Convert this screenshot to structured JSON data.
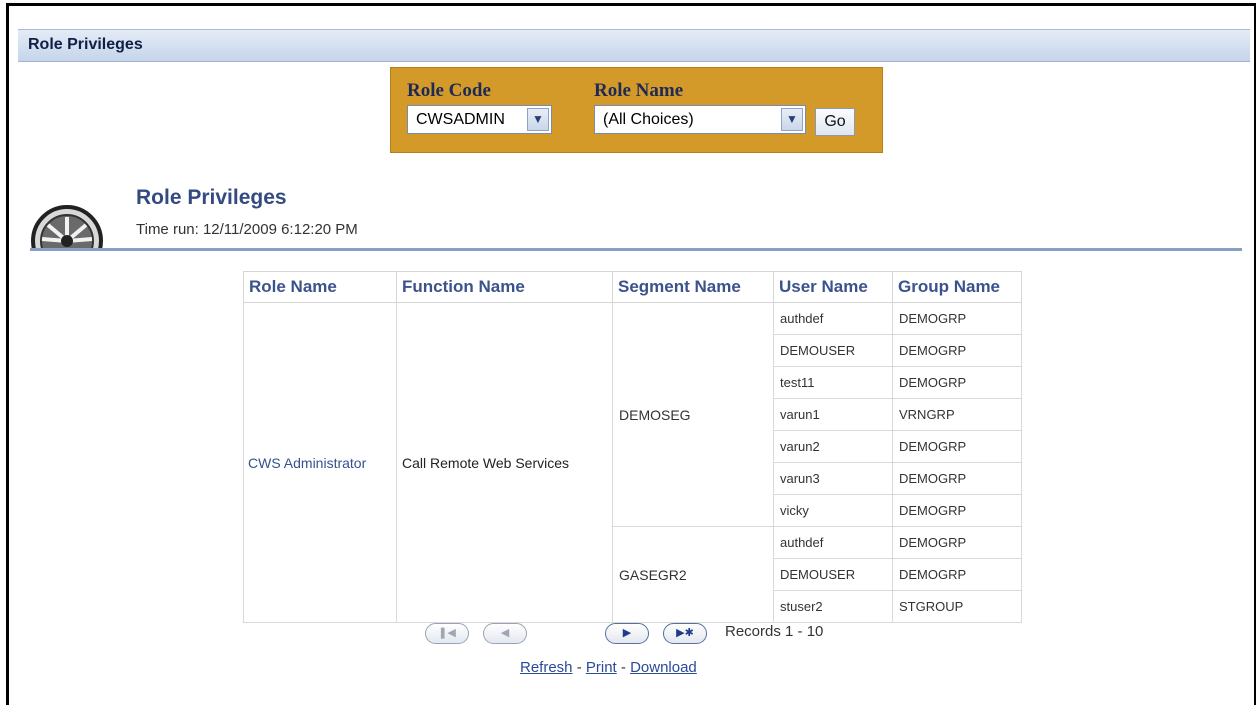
{
  "header": {
    "title": "Role Privileges"
  },
  "prompt": {
    "role_code_label": "Role Code",
    "role_code_value": "CWSADMIN",
    "role_name_label": "Role Name",
    "role_name_value": "(All Choices)",
    "go_label": "Go"
  },
  "report": {
    "title": "Role Privileges",
    "time_run": "Time run: 12/11/2009 6:12:20 PM"
  },
  "table": {
    "columns": [
      "Role Name",
      "Function Name",
      "Segment Name",
      "User Name",
      "Group Name"
    ],
    "role_name": "CWS Administrator",
    "function_name": "Call Remote Web Services",
    "segments": [
      {
        "name": "DEMOSEG",
        "rows": [
          {
            "user": "authdef",
            "group": "DEMOGRP"
          },
          {
            "user": "DEMOUSER",
            "group": "DEMOGRP"
          },
          {
            "user": "test11",
            "group": "DEMOGRP"
          },
          {
            "user": "varun1",
            "group": "VRNGRP"
          },
          {
            "user": "varun2",
            "group": "DEMOGRP"
          },
          {
            "user": "varun3",
            "group": "DEMOGRP"
          },
          {
            "user": "vicky",
            "group": "DEMOGRP"
          }
        ]
      },
      {
        "name": "GASEGR2",
        "rows": [
          {
            "user": "authdef",
            "group": "DEMOGRP"
          },
          {
            "user": "DEMOUSER",
            "group": "DEMOGRP"
          },
          {
            "user": "stuser2",
            "group": "STGROUP"
          }
        ]
      }
    ]
  },
  "pager": {
    "first_icon": "first-page-icon",
    "prev_icon": "previous-page-icon",
    "next_icon": "next-page-icon",
    "last_icon": "last-page-icon",
    "records": "Records 1 - 10"
  },
  "links": {
    "refresh": "Refresh",
    "print": "Print",
    "download": "Download",
    "separator": " - "
  },
  "colors": {
    "prompt_bg": "#d39a2a",
    "header_text": "#0f1f45",
    "title_text": "#344b82",
    "link": "#2a4a9a"
  }
}
